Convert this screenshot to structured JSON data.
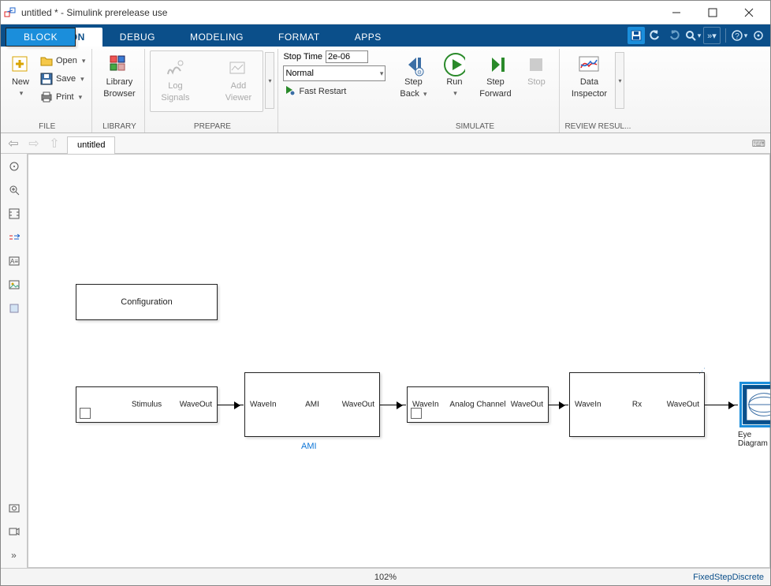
{
  "window": {
    "title": "untitled * - Simulink prerelease use"
  },
  "tabs": {
    "simulation": "SIMULATION",
    "debug": "DEBUG",
    "modeling": "MODELING",
    "format": "FORMAT",
    "apps": "APPS",
    "block": "BLOCK"
  },
  "ribbon": {
    "file": {
      "new": "New",
      "open": "Open",
      "save": "Save",
      "print": "Print",
      "group": "FILE"
    },
    "library": {
      "browser": "Library\nBrowser",
      "browser_l1": "Library",
      "browser_l2": "Browser",
      "group": "LIBRARY"
    },
    "prepare": {
      "log_l1": "Log",
      "log_l2": "Signals",
      "add_l1": "Add",
      "add_l2": "Viewer",
      "group": "PREPARE"
    },
    "simparams": {
      "stoptime_label": "Stop Time",
      "stoptime_value": "2e-06",
      "mode": "Normal",
      "fast_restart": "Fast Restart"
    },
    "simulate": {
      "stepback_l1": "Step",
      "stepback_l2": "Back",
      "run": "Run",
      "stepfwd_l1": "Step",
      "stepfwd_l2": "Forward",
      "stop": "Stop",
      "group": "SIMULATE"
    },
    "review": {
      "di_l1": "Data",
      "di_l2": "Inspector",
      "group": "REVIEW RESUL..."
    }
  },
  "nav": {
    "doc_tab": "untitled"
  },
  "canvas": {
    "configuration": "Configuration",
    "stimulus": "Stimulus",
    "ami": "AMI",
    "ami_name": "AMI",
    "analog": "Analog Channel",
    "rx": "Rx",
    "eye": "Eye Diagram",
    "wavein": "WaveIn",
    "waveout": "WaveOut"
  },
  "status": {
    "zoom": "102%",
    "solver": "FixedStepDiscrete"
  }
}
